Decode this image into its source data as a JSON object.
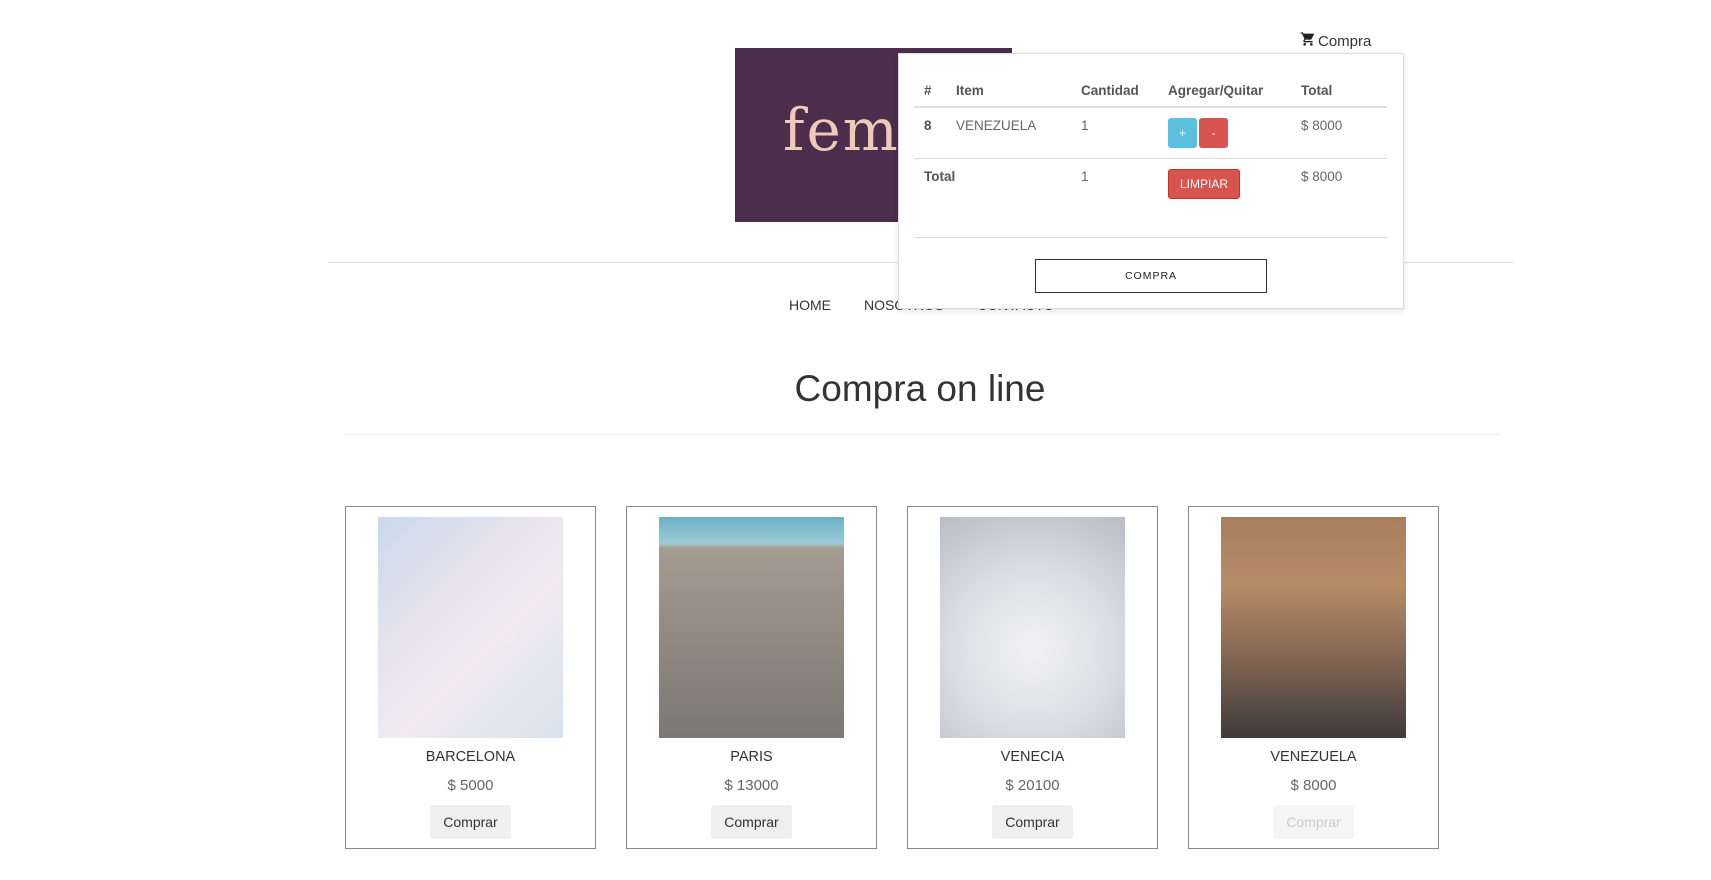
{
  "header": {
    "cart_label": "Compra",
    "logo_text": "femi"
  },
  "nav": {
    "items": [
      "HOME",
      "NOSOTROS",
      "CONTACTO"
    ]
  },
  "cart": {
    "columns": [
      "#",
      "Item",
      "Cantidad",
      "Agregar/Quitar",
      "Total"
    ],
    "rows": [
      {
        "id": "8",
        "item": "VENEZUELA",
        "qty": "1",
        "add_label": "+",
        "remove_label": "-",
        "total": "$ 8000"
      }
    ],
    "total_row": {
      "label": "Total",
      "qty": "1",
      "clear_label": "LIMPIAR",
      "total": "$ 8000"
    },
    "checkout_label": "COMPRA"
  },
  "page": {
    "title": "Compra on line"
  },
  "products": [
    {
      "name": "BARCELONA",
      "price": "$ 5000",
      "button": "Comprar",
      "enabled": true
    },
    {
      "name": "PARIS",
      "price": "$ 13000",
      "button": "Comprar",
      "enabled": true
    },
    {
      "name": "VENECIA",
      "price": "$ 20100",
      "button": "Comprar",
      "enabled": true
    },
    {
      "name": "VENEZUELA",
      "price": "$ 8000",
      "button": "Comprar",
      "enabled": false
    }
  ],
  "colors": {
    "logo_bg": "#4a2e4c",
    "logo_text": "#f0c9b8",
    "info": "#5bc0de",
    "danger": "#d9534f"
  }
}
